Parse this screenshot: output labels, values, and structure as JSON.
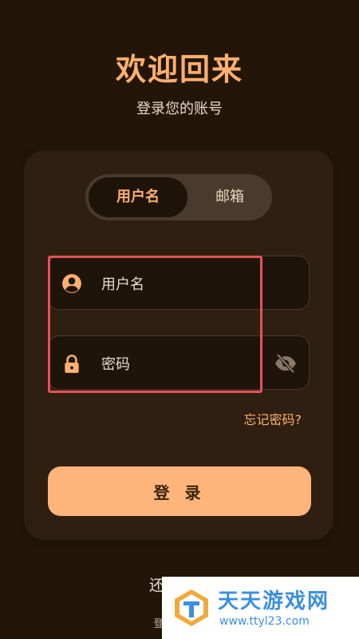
{
  "header": {
    "title": "欢迎回来",
    "subtitle": "登录您的账号"
  },
  "tabs": {
    "active": "用户名",
    "inactive": "邮箱"
  },
  "form": {
    "username_placeholder": "用户名",
    "password_placeholder": "密码",
    "forgot_label": "忘记密码?",
    "login_label": "登 录"
  },
  "footer": {
    "register_text": "还没有账",
    "terms_text": "登录即代表"
  },
  "watermark": {
    "name": "天天游戏网",
    "url": "www.ttyl23.com"
  },
  "colors": {
    "background": "#231609",
    "card": "#2e1f11",
    "accent": "#ffb06e",
    "button": "#ffb57a",
    "highlight": "#e8505a"
  },
  "icons": {
    "username": "user-circle-icon",
    "password": "lock-icon",
    "visibility": "eye-off-icon"
  }
}
